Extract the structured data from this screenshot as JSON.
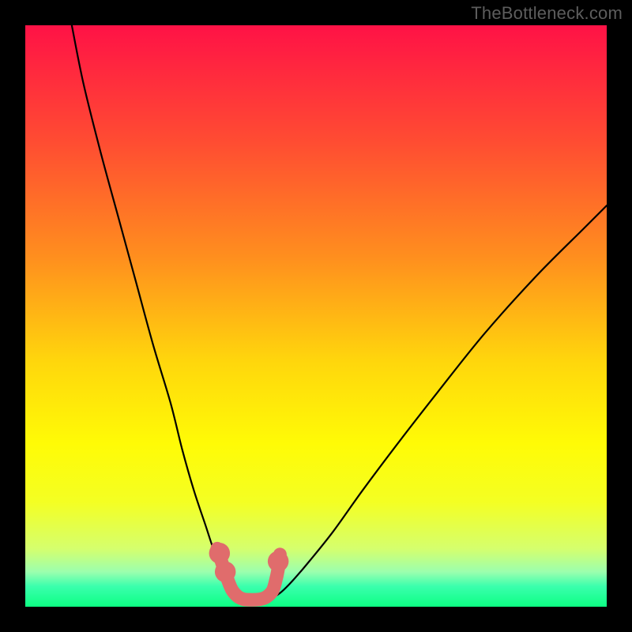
{
  "watermark": "TheBottleneck.com",
  "chart_data": {
    "type": "line",
    "title": "",
    "xlabel": "",
    "ylabel": "",
    "xlim": [
      0,
      100
    ],
    "ylim": [
      0,
      100
    ],
    "background_gradient": {
      "stops": [
        {
          "pos": 0.0,
          "color": "#ff1246"
        },
        {
          "pos": 0.2,
          "color": "#ff4c32"
        },
        {
          "pos": 0.4,
          "color": "#ff8f1e"
        },
        {
          "pos": 0.58,
          "color": "#ffd70c"
        },
        {
          "pos": 0.72,
          "color": "#fffb06"
        },
        {
          "pos": 0.82,
          "color": "#f4ff23"
        },
        {
          "pos": 0.9,
          "color": "#d5ff6d"
        },
        {
          "pos": 0.94,
          "color": "#9cffae"
        },
        {
          "pos": 0.965,
          "color": "#3affad"
        },
        {
          "pos": 1.0,
          "color": "#0dff83"
        }
      ]
    },
    "series": [
      {
        "name": "left-branch",
        "color": "#000000",
        "x": [
          8,
          10,
          13,
          16,
          19,
          22,
          25,
          27,
          29,
          31,
          32.5,
          34,
          35,
          36,
          36.8
        ],
        "y": [
          100,
          90,
          78,
          67,
          56,
          45,
          35,
          27,
          20,
          14,
          9.5,
          6,
          4,
          2.5,
          1.5
        ]
      },
      {
        "name": "right-branch",
        "color": "#000000",
        "x": [
          42.5,
          44,
          46,
          49,
          53,
          58,
          64,
          71,
          79,
          88,
          96,
          100
        ],
        "y": [
          1.5,
          2.5,
          4.5,
          8,
          13,
          20,
          28,
          37,
          47,
          57,
          65,
          69
        ]
      },
      {
        "name": "well-bottom-salmon",
        "color": "#e06c6c",
        "x": [
          33.0,
          34.0,
          34.5,
          35.5,
          36.5,
          37.5,
          38.5,
          39.5,
          40.5,
          41.5,
          42.5,
          43.0,
          43.5,
          43.8
        ],
        "y": [
          10.0,
          7.0,
          5.5,
          3.0,
          1.8,
          1.3,
          1.2,
          1.2,
          1.3,
          1.7,
          2.7,
          4.2,
          6.5,
          9.0
        ]
      }
    ],
    "markers": [
      {
        "name": "left-dot-upper",
        "x": 33.4,
        "y": 9.2,
        "r": 1.8,
        "color": "#e06c6c"
      },
      {
        "name": "left-dot-lower",
        "x": 34.4,
        "y": 6.0,
        "r": 1.8,
        "color": "#e06c6c"
      },
      {
        "name": "right-dot",
        "x": 43.5,
        "y": 7.8,
        "r": 1.8,
        "color": "#e06c6c"
      }
    ]
  }
}
